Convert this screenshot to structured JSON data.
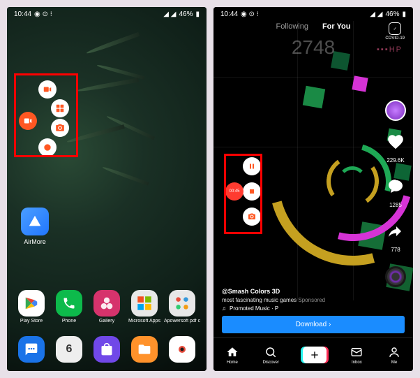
{
  "status": {
    "time": "10:44",
    "battery": "46%"
  },
  "home": {
    "airmore_label": "AirMore",
    "apps_row1": [
      {
        "label": "Play Store"
      },
      {
        "label": "Phone"
      },
      {
        "label": "Gallery"
      },
      {
        "label": "Microsoft Apps"
      },
      {
        "label": "Apowersoft pdf conve"
      }
    ],
    "apps_row2": []
  },
  "tiktok": {
    "tabs": {
      "following": "Following",
      "foryou": "For You"
    },
    "covid_label": "COVID-19",
    "score": "2748",
    "hp_label": "▪▪▪HP",
    "recorder_time": "00:45",
    "side": {
      "likes": "229.6K",
      "comments": "1285",
      "shares": "778"
    },
    "caption": {
      "user": "@Smash Colors 3D",
      "desc": "most fascinating music games",
      "sponsored": "Sponsored",
      "music": "Promoted Music · P"
    },
    "download_btn": "Download ›",
    "nav": {
      "home": "Home",
      "discover": "Discover",
      "inbox": "Inbox",
      "me": "Me"
    }
  }
}
